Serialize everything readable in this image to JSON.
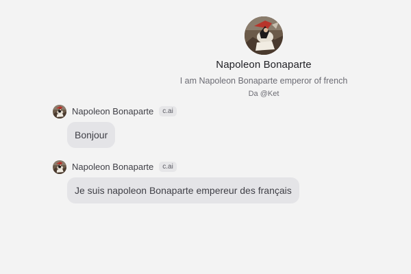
{
  "character": {
    "name": "Napoleon Bonaparte",
    "description": "I am Napoleon Bonaparte emperor of french",
    "creator": "Da @Ket",
    "avatar_icon": "napoleon-portrait"
  },
  "messages": [
    {
      "author": "Napoleon Bonaparte",
      "badge": "c.ai",
      "text": "Bonjour"
    },
    {
      "author": "Napoleon Bonaparte",
      "badge": "c.ai",
      "text": "Je suis napoleon Bonaparte empereur des français"
    }
  ],
  "colors": {
    "background": "#f3f3f3",
    "bubble": "#e4e4e7",
    "badge": "#e6e6e8"
  }
}
